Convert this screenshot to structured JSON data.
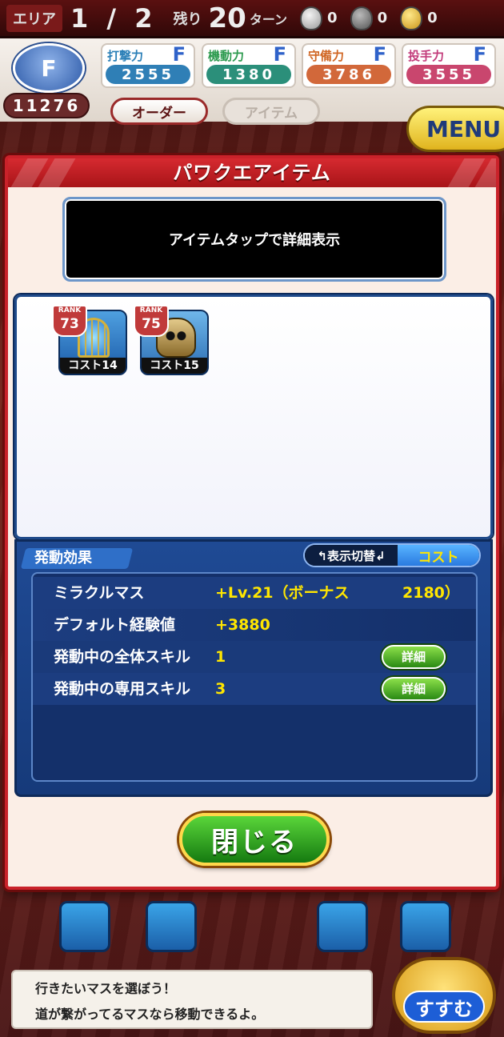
{
  "hud": {
    "area_label": "エリア",
    "area_value": "1 / 2",
    "remain_label": "残り",
    "turns": "20",
    "turn_unit": "ターン",
    "bags": [
      {
        "icon": "bag-white-icon",
        "count": "0"
      },
      {
        "icon": "bag-dark-icon",
        "count": "0"
      },
      {
        "icon": "bag-gold-icon",
        "count": "0"
      }
    ]
  },
  "team": {
    "rank": "F",
    "power": "11276",
    "stats": [
      {
        "label": "打撃力",
        "grade": "F",
        "value": "2555"
      },
      {
        "label": "機動力",
        "grade": "F",
        "value": "1380"
      },
      {
        "label": "守備力",
        "grade": "F",
        "value": "3786"
      },
      {
        "label": "投手力",
        "grade": "F",
        "value": "3555"
      }
    ],
    "order_label": "オーダー",
    "item_tab_label": "アイテム",
    "menu_label": "MENU"
  },
  "modal": {
    "title": "パワクエアイテム",
    "info_text": "アイテムタップで詳細表示",
    "items": [
      {
        "rank_label": "RANK",
        "rank": "73",
        "cost": "コスト14",
        "icon": "birdcage-icon"
      },
      {
        "rank_label": "RANK",
        "rank": "75",
        "cost": "コスト15",
        "icon": "skull-mask-icon"
      }
    ],
    "effects_tab": "発動効果",
    "toggle_label": "↰表示切替↲",
    "toggle_value": "コスト",
    "effects": [
      {
        "label": "ミラクルマス",
        "value": "+Lv.21（ボーナス",
        "value2": "2180）"
      },
      {
        "label": "デフォルト経験値",
        "value": "+3880"
      },
      {
        "label": "発動中の全体スキル",
        "value": "1",
        "detail": "詳細"
      },
      {
        "label": "発動中の専用スキル",
        "value": "3",
        "detail": "詳細"
      }
    ],
    "close_label": "閉じる"
  },
  "message": {
    "line1": "行きたいマスを選ぼう！",
    "line2": "道が繋がってるマスなら移動できるよ。"
  },
  "go_button": "すすむ",
  "colors": {
    "modal_border": "#c9222a",
    "highlight_text": "#ffe600",
    "panel_blue": "#1f4a94",
    "close_green": "#2aa01a"
  }
}
